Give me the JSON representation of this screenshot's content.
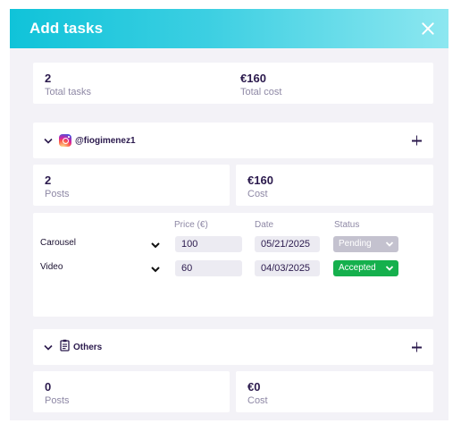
{
  "modal": {
    "title": "Add tasks",
    "close_icon": "close-icon"
  },
  "summary": {
    "total_tasks_value": "2",
    "total_tasks_label": "Total tasks",
    "total_cost_value": "€160",
    "total_cost_label": "Total cost"
  },
  "instagram_section": {
    "icon": "instagram-icon",
    "handle": "@fiogimenez1",
    "posts_value": "2",
    "posts_label": "Posts",
    "cost_value": "€160",
    "cost_label": "Cost",
    "columns": {
      "price": "Price (€)",
      "date": "Date",
      "status": "Status"
    },
    "rows": [
      {
        "type": "Carousel",
        "price": "100",
        "date": "05/21/2025",
        "status": "Pending"
      },
      {
        "type": "Video",
        "price": "60",
        "date": "04/03/2025",
        "status": "Accepted"
      }
    ]
  },
  "others_section": {
    "icon": "clipboard-icon",
    "name": "Others",
    "posts_value": "0",
    "posts_label": "Posts",
    "cost_value": "€0",
    "cost_label": "Cost"
  },
  "colors": {
    "header_gradient_start": "#10c3d9",
    "header_gradient_end": "#8de7f0",
    "accepted": "#15b04d",
    "pending": "#c4c2cf",
    "text_primary": "#2b1a4d",
    "text_muted": "#8e88a5"
  }
}
